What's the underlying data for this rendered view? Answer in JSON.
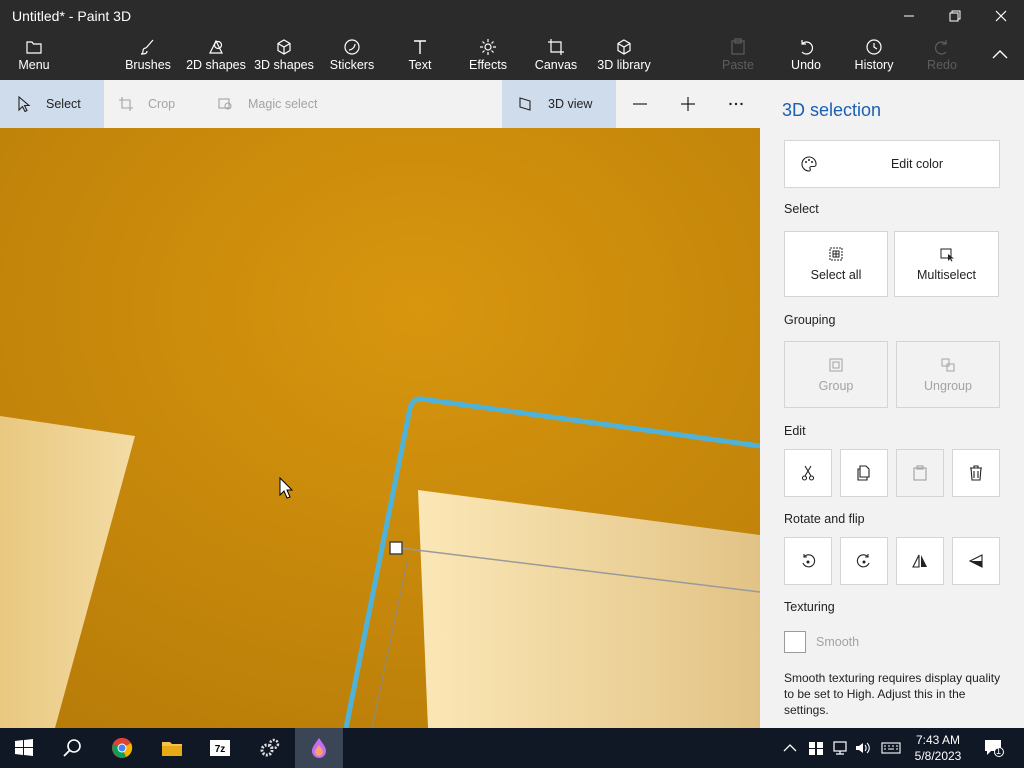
{
  "window": {
    "title": "Untitled* - Paint 3D"
  },
  "ribbon": {
    "menu": "Menu",
    "brushes": "Brushes",
    "shapes2d": "2D shapes",
    "shapes3d": "3D shapes",
    "stickers": "Stickers",
    "text": "Text",
    "effects": "Effects",
    "canvas": "Canvas",
    "library": "3D library",
    "paste": "Paste",
    "undo": "Undo",
    "history": "History",
    "redo": "Redo"
  },
  "toolbar": {
    "select": "Select",
    "crop": "Crop",
    "magic_select": "Magic select",
    "view3d": "3D view"
  },
  "panel": {
    "title": "3D selection",
    "edit_color": "Edit color",
    "select_label": "Select",
    "select_all": "Select all",
    "multiselect": "Multiselect",
    "grouping_label": "Grouping",
    "group": "Group",
    "ungroup": "Ungroup",
    "edit_label": "Edit",
    "rotate_label": "Rotate and flip",
    "texturing_label": "Texturing",
    "smooth": "Smooth",
    "smooth_note": "Smooth texturing requires display quality to be set to High. Adjust this in the settings."
  },
  "taskbar": {
    "time": "7:43 AM",
    "date": "5/8/2023",
    "notification_count": "1"
  },
  "colors": {
    "canvas_bg": "#c98a0c",
    "selection_outline": "#4fb3d9",
    "accent": "#1a5fb4",
    "ribbon_bg": "#2b2b2b"
  }
}
